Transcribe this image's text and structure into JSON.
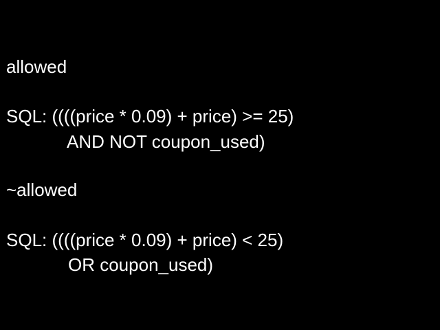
{
  "slide": {
    "section1": {
      "heading": "allowed",
      "sql_line1": "SQL: ((((price * 0.09) + price) >= 25)",
      "sql_line2": "AND NOT coupon_used)"
    },
    "section2": {
      "heading": "~allowed",
      "sql_line1": "SQL: ((((price * 0.09) + price) < 25)",
      "sql_line2": "OR coupon_used)"
    }
  },
  "colors": {
    "background": "#000000",
    "text": "#ffffff"
  }
}
